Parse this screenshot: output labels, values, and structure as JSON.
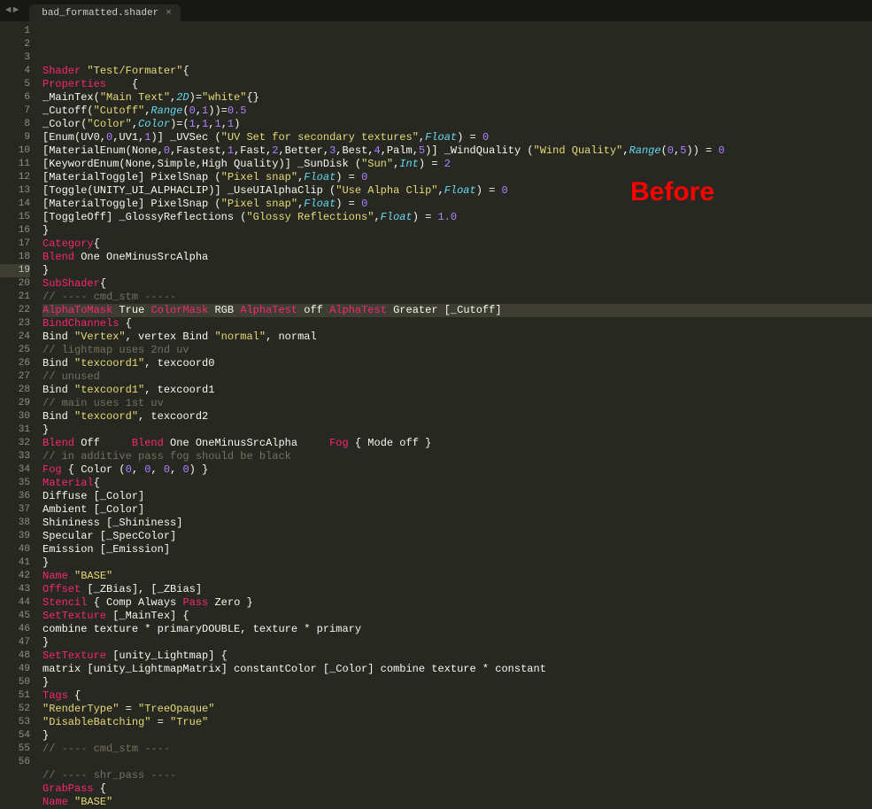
{
  "tab": {
    "title": "bad_formatted.shader",
    "close": "×"
  },
  "nav": {
    "back": "◄",
    "forward": "►"
  },
  "overlay": "Before",
  "active_line": 19,
  "lines": [
    {
      "n": 1,
      "tokens": [
        [
          "kw",
          "Shader"
        ],
        [
          "plain",
          " "
        ],
        [
          "str",
          "\"Test/Formater\""
        ],
        [
          "plain",
          "{"
        ]
      ]
    },
    {
      "n": 2,
      "tokens": [
        [
          "kw",
          "Properties"
        ],
        [
          "plain",
          "    {"
        ]
      ]
    },
    {
      "n": 3,
      "tokens": [
        [
          "plain",
          "_MainTex("
        ],
        [
          "str",
          "\"Main Text\""
        ],
        [
          "plain",
          ","
        ],
        [
          "type",
          "2D"
        ],
        [
          "plain",
          ")="
        ],
        [
          "str",
          "\"white\""
        ],
        [
          "plain",
          "{}"
        ]
      ]
    },
    {
      "n": 4,
      "tokens": [
        [
          "plain",
          "_Cutoff("
        ],
        [
          "str",
          "\"Cutoff\""
        ],
        [
          "plain",
          ","
        ],
        [
          "type",
          "Range"
        ],
        [
          "plain",
          "("
        ],
        [
          "num",
          "0"
        ],
        [
          "plain",
          ","
        ],
        [
          "num",
          "1"
        ],
        [
          "plain",
          "))="
        ],
        [
          "num",
          "0.5"
        ]
      ]
    },
    {
      "n": 5,
      "tokens": [
        [
          "plain",
          "_Color("
        ],
        [
          "str",
          "\"Color\""
        ],
        [
          "plain",
          ","
        ],
        [
          "type",
          "Color"
        ],
        [
          "plain",
          ")=("
        ],
        [
          "num",
          "1"
        ],
        [
          "plain",
          ","
        ],
        [
          "num",
          "1"
        ],
        [
          "plain",
          ","
        ],
        [
          "num",
          "1"
        ],
        [
          "plain",
          ","
        ],
        [
          "num",
          "1"
        ],
        [
          "plain",
          ")"
        ]
      ]
    },
    {
      "n": 6,
      "tokens": [
        [
          "plain",
          "[Enum(UV0,"
        ],
        [
          "num",
          "0"
        ],
        [
          "plain",
          ",UV1,"
        ],
        [
          "num",
          "1"
        ],
        [
          "plain",
          ")] _UVSec ("
        ],
        [
          "str",
          "\"UV Set for secondary textures\""
        ],
        [
          "plain",
          ","
        ],
        [
          "type",
          "Float"
        ],
        [
          "plain",
          ") = "
        ],
        [
          "num",
          "0"
        ]
      ]
    },
    {
      "n": 7,
      "tokens": [
        [
          "plain",
          "[MaterialEnum(None,"
        ],
        [
          "num",
          "0"
        ],
        [
          "plain",
          ",Fastest,"
        ],
        [
          "num",
          "1"
        ],
        [
          "plain",
          ",Fast,"
        ],
        [
          "num",
          "2"
        ],
        [
          "plain",
          ",Better,"
        ],
        [
          "num",
          "3"
        ],
        [
          "plain",
          ",Best,"
        ],
        [
          "num",
          "4"
        ],
        [
          "plain",
          ",Palm,"
        ],
        [
          "num",
          "5"
        ],
        [
          "plain",
          ")] _WindQuality ("
        ],
        [
          "str",
          "\"Wind Quality\""
        ],
        [
          "plain",
          ","
        ],
        [
          "type",
          "Range"
        ],
        [
          "plain",
          "("
        ],
        [
          "num",
          "0"
        ],
        [
          "plain",
          ","
        ],
        [
          "num",
          "5"
        ],
        [
          "plain",
          ")) = "
        ],
        [
          "num",
          "0"
        ]
      ]
    },
    {
      "n": 8,
      "tokens": [
        [
          "plain",
          "[KeywordEnum(None,Simple,High Quality)] _SunDisk ("
        ],
        [
          "str",
          "\"Sun\""
        ],
        [
          "plain",
          ","
        ],
        [
          "type",
          "Int"
        ],
        [
          "plain",
          ") = "
        ],
        [
          "num",
          "2"
        ]
      ]
    },
    {
      "n": 9,
      "tokens": [
        [
          "plain",
          "[MaterialToggle] PixelSnap ("
        ],
        [
          "str",
          "\"Pixel snap\""
        ],
        [
          "plain",
          ","
        ],
        [
          "type",
          "Float"
        ],
        [
          "plain",
          ") = "
        ],
        [
          "num",
          "0"
        ]
      ]
    },
    {
      "n": 10,
      "tokens": [
        [
          "plain",
          "[Toggle(UNITY_UI_ALPHACLIP)] _UseUIAlphaClip ("
        ],
        [
          "str",
          "\"Use Alpha Clip\""
        ],
        [
          "plain",
          ","
        ],
        [
          "type",
          "Float"
        ],
        [
          "plain",
          ") = "
        ],
        [
          "num",
          "0"
        ]
      ]
    },
    {
      "n": 11,
      "tokens": [
        [
          "plain",
          "[MaterialToggle] PixelSnap ("
        ],
        [
          "str",
          "\"Pixel snap\""
        ],
        [
          "plain",
          ","
        ],
        [
          "type",
          "Float"
        ],
        [
          "plain",
          ") = "
        ],
        [
          "num",
          "0"
        ]
      ]
    },
    {
      "n": 12,
      "tokens": [
        [
          "plain",
          "[ToggleOff] _GlossyReflections ("
        ],
        [
          "str",
          "\"Glossy Reflections\""
        ],
        [
          "plain",
          ","
        ],
        [
          "type",
          "Float"
        ],
        [
          "plain",
          ") = "
        ],
        [
          "num",
          "1.0"
        ]
      ]
    },
    {
      "n": 13,
      "tokens": [
        [
          "plain",
          "}"
        ]
      ]
    },
    {
      "n": 14,
      "tokens": [
        [
          "kw",
          "Category"
        ],
        [
          "plain",
          "{"
        ]
      ]
    },
    {
      "n": 15,
      "tokens": [
        [
          "kw",
          "Blend"
        ],
        [
          "plain",
          " One OneMinusSrcAlpha"
        ]
      ]
    },
    {
      "n": 16,
      "tokens": [
        [
          "plain",
          "}"
        ]
      ]
    },
    {
      "n": 17,
      "tokens": [
        [
          "kw",
          "SubShader"
        ],
        [
          "plain",
          "{"
        ]
      ]
    },
    {
      "n": 18,
      "tokens": [
        [
          "cmt",
          "// ---- cmd_stm -----"
        ]
      ]
    },
    {
      "n": 19,
      "tokens": [
        [
          "kw",
          "AlphaToMask"
        ],
        [
          "plain",
          " True "
        ],
        [
          "kw",
          "ColorMask"
        ],
        [
          "plain",
          " RGB "
        ],
        [
          "kw",
          "AlphaTest"
        ],
        [
          "plain",
          " off "
        ],
        [
          "kw",
          "AlphaTest"
        ],
        [
          "plain",
          " Greater [_Cutoff]"
        ]
      ]
    },
    {
      "n": 20,
      "tokens": [
        [
          "kw",
          "BindChannels"
        ],
        [
          "plain",
          " {"
        ]
      ]
    },
    {
      "n": 21,
      "tokens": [
        [
          "plain",
          "Bind "
        ],
        [
          "str",
          "\"Vertex\""
        ],
        [
          "plain",
          ", vertex Bind "
        ],
        [
          "str",
          "\"normal\""
        ],
        [
          "plain",
          ", normal"
        ]
      ]
    },
    {
      "n": 22,
      "tokens": [
        [
          "cmt",
          "// lightmap uses 2nd uv"
        ]
      ]
    },
    {
      "n": 23,
      "tokens": [
        [
          "plain",
          "Bind "
        ],
        [
          "str",
          "\"texcoord1\""
        ],
        [
          "plain",
          ", texcoord0"
        ]
      ]
    },
    {
      "n": 24,
      "tokens": [
        [
          "cmt",
          "// unused"
        ]
      ]
    },
    {
      "n": 25,
      "tokens": [
        [
          "plain",
          "Bind "
        ],
        [
          "str",
          "\"texcoord1\""
        ],
        [
          "plain",
          ", texcoord1"
        ]
      ]
    },
    {
      "n": 26,
      "tokens": [
        [
          "cmt",
          "// main uses 1st uv"
        ]
      ]
    },
    {
      "n": 27,
      "tokens": [
        [
          "plain",
          "Bind "
        ],
        [
          "str",
          "\"texcoord\""
        ],
        [
          "plain",
          ", texcoord2"
        ]
      ]
    },
    {
      "n": 28,
      "tokens": [
        [
          "plain",
          "}"
        ]
      ]
    },
    {
      "n": 29,
      "tokens": [
        [
          "kw",
          "Blend"
        ],
        [
          "plain",
          " Off     "
        ],
        [
          "kw",
          "Blend"
        ],
        [
          "plain",
          " One OneMinusSrcAlpha     "
        ],
        [
          "kw",
          "Fog"
        ],
        [
          "plain",
          " { Mode off }"
        ]
      ]
    },
    {
      "n": 30,
      "tokens": [
        [
          "cmt",
          "// in additive pass fog should be black"
        ]
      ]
    },
    {
      "n": 31,
      "tokens": [
        [
          "kw",
          "Fog"
        ],
        [
          "plain",
          " { Color ("
        ],
        [
          "num",
          "0"
        ],
        [
          "plain",
          ", "
        ],
        [
          "num",
          "0"
        ],
        [
          "plain",
          ", "
        ],
        [
          "num",
          "0"
        ],
        [
          "plain",
          ", "
        ],
        [
          "num",
          "0"
        ],
        [
          "plain",
          ") }"
        ]
      ]
    },
    {
      "n": 32,
      "tokens": [
        [
          "kw",
          "Material"
        ],
        [
          "plain",
          "{"
        ]
      ]
    },
    {
      "n": 33,
      "tokens": [
        [
          "plain",
          "Diffuse [_Color]"
        ]
      ]
    },
    {
      "n": 34,
      "tokens": [
        [
          "plain",
          "Ambient [_Color]"
        ]
      ]
    },
    {
      "n": 35,
      "tokens": [
        [
          "plain",
          "Shininess [_Shininess]"
        ]
      ]
    },
    {
      "n": 36,
      "tokens": [
        [
          "plain",
          "Specular [_SpecColor]"
        ]
      ]
    },
    {
      "n": 37,
      "tokens": [
        [
          "plain",
          "Emission [_Emission]"
        ]
      ]
    },
    {
      "n": 38,
      "tokens": [
        [
          "plain",
          "}"
        ]
      ]
    },
    {
      "n": 39,
      "tokens": [
        [
          "kw",
          "Name"
        ],
        [
          "plain",
          " "
        ],
        [
          "str",
          "\"BASE\""
        ]
      ]
    },
    {
      "n": 40,
      "tokens": [
        [
          "kw",
          "Offset"
        ],
        [
          "plain",
          " [_ZBias], [_ZBias]"
        ]
      ]
    },
    {
      "n": 41,
      "tokens": [
        [
          "kw",
          "Stencil"
        ],
        [
          "plain",
          " { Comp Always "
        ],
        [
          "kw",
          "Pass"
        ],
        [
          "plain",
          " Zero }"
        ]
      ]
    },
    {
      "n": 42,
      "tokens": [
        [
          "kw",
          "SetTexture"
        ],
        [
          "plain",
          " [_MainTex] {"
        ]
      ]
    },
    {
      "n": 43,
      "tokens": [
        [
          "plain",
          "combine texture * primaryDOUBLE, texture * primary"
        ]
      ]
    },
    {
      "n": 44,
      "tokens": [
        [
          "plain",
          "}"
        ]
      ]
    },
    {
      "n": 45,
      "tokens": [
        [
          "kw",
          "SetTexture"
        ],
        [
          "plain",
          " [unity_Lightmap] {"
        ]
      ]
    },
    {
      "n": 46,
      "tokens": [
        [
          "plain",
          "matrix [unity_LightmapMatrix] constantColor [_Color] combine texture * constant"
        ]
      ]
    },
    {
      "n": 47,
      "tokens": [
        [
          "plain",
          "}"
        ]
      ]
    },
    {
      "n": 48,
      "tokens": [
        [
          "kw",
          "Tags"
        ],
        [
          "plain",
          " {"
        ]
      ]
    },
    {
      "n": 49,
      "tokens": [
        [
          "str",
          "\"RenderType\""
        ],
        [
          "plain",
          " = "
        ],
        [
          "str",
          "\"TreeOpaque\""
        ]
      ]
    },
    {
      "n": 50,
      "tokens": [
        [
          "str",
          "\"DisableBatching\""
        ],
        [
          "plain",
          " = "
        ],
        [
          "str",
          "\"True\""
        ]
      ]
    },
    {
      "n": 51,
      "tokens": [
        [
          "plain",
          "}"
        ]
      ]
    },
    {
      "n": 52,
      "tokens": [
        [
          "cmt",
          "// ---- cmd_stm ----"
        ]
      ]
    },
    {
      "n": 53,
      "tokens": [
        [
          "plain",
          ""
        ]
      ]
    },
    {
      "n": 54,
      "tokens": [
        [
          "cmt",
          "// ---- shr_pass ----"
        ]
      ]
    },
    {
      "n": 55,
      "tokens": [
        [
          "kw",
          "GrabPass"
        ],
        [
          "plain",
          " {"
        ]
      ]
    },
    {
      "n": 56,
      "tokens": [
        [
          "kw",
          "Name"
        ],
        [
          "plain",
          " "
        ],
        [
          "str",
          "\"BASE\""
        ]
      ]
    }
  ]
}
